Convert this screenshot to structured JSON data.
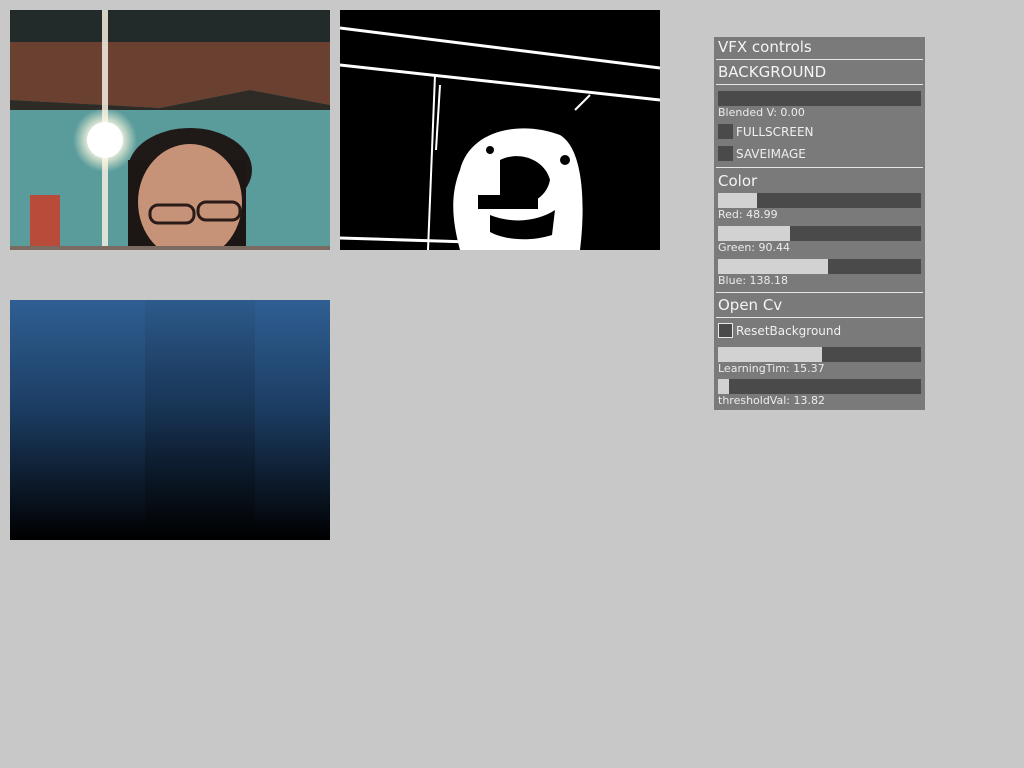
{
  "panel": {
    "title": "VFX controls",
    "sections": {
      "background": "BACKGROUND",
      "color": "Color",
      "opencv": "Open Cv"
    },
    "blended": {
      "label": "Blended V: 0.00",
      "value": 0.0
    },
    "fullscreen": {
      "label": "FULLSCREEN",
      "checked": false
    },
    "saveimage": {
      "label": "SAVEIMAGE",
      "checked": false
    },
    "red": {
      "label": "Red: 48.99",
      "value": 48.99,
      "max": 255
    },
    "green": {
      "label": "Green: 90.44",
      "value": 90.44,
      "max": 255
    },
    "blue": {
      "label": "Blue: 138.18",
      "value": 138.18,
      "max": 255
    },
    "reset_background": {
      "label": "ResetBackground",
      "checked": false
    },
    "learning": {
      "label": "LearningTim: 15.37",
      "value": 15.37,
      "max": 30
    },
    "threshold": {
      "label": "thresholdVal: 13.82",
      "value": 13.82,
      "max": 255
    }
  },
  "colors": {
    "background": "#c8c8c8",
    "panel": "#7a7a7a",
    "slider_track": "#4a4a4a",
    "slider_fill": "#d2d2d2",
    "blended_top": "#2e5c90",
    "blended_bottom": "#000000"
  }
}
